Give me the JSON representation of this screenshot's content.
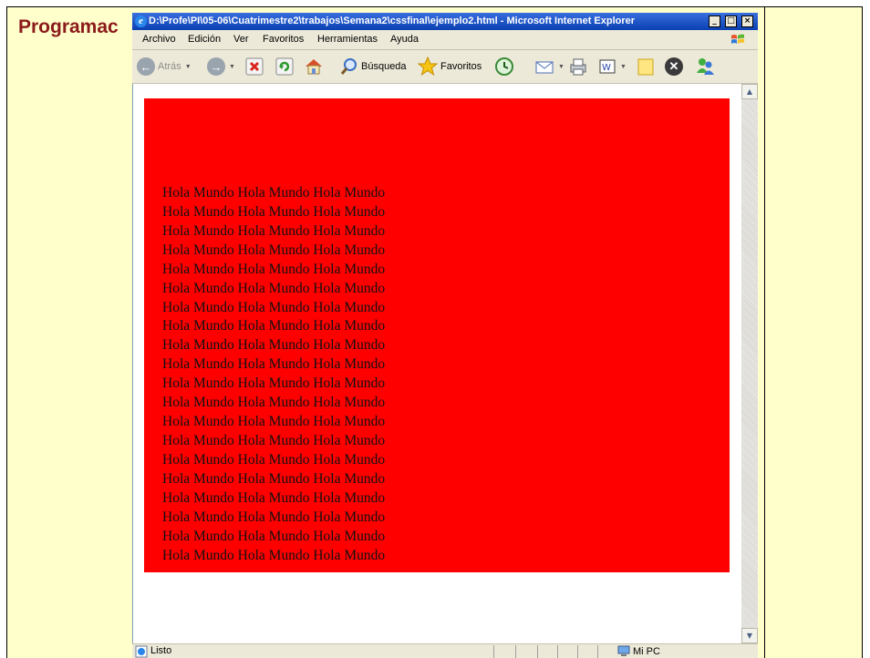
{
  "slide": {
    "title": "Programac"
  },
  "window": {
    "title": "D:\\Profe\\PI\\05-06\\Cuatrimestre2\\trabajos\\Semana2\\cssfinal\\ejemplo2.html - Microsoft Internet Explorer",
    "minimize": "_",
    "maximize": "□",
    "close": "×"
  },
  "menu": {
    "items": [
      "Archivo",
      "Edición",
      "Ver",
      "Favoritos",
      "Herramientas",
      "Ayuda"
    ]
  },
  "toolbar": {
    "back_label": "Atrás",
    "search_label": "Búsqueda",
    "favorites_label": "Favoritos"
  },
  "content": {
    "background_color": "#ff0000",
    "lines": [
      "Hola Mundo Hola Mundo Hola Mundo",
      "Hola Mundo Hola Mundo Hola Mundo",
      "Hola Mundo Hola Mundo Hola Mundo",
      "Hola Mundo Hola Mundo Hola Mundo",
      "Hola Mundo Hola Mundo Hola Mundo",
      "Hola Mundo Hola Mundo Hola Mundo",
      "Hola Mundo Hola Mundo Hola Mundo",
      "Hola Mundo Hola Mundo Hola Mundo",
      "Hola Mundo Hola Mundo Hola Mundo",
      "Hola Mundo Hola Mundo Hola Mundo",
      "Hola Mundo Hola Mundo Hola Mundo",
      "Hola Mundo Hola Mundo Hola Mundo",
      "Hola Mundo Hola Mundo Hola Mundo",
      "Hola Mundo Hola Mundo Hola Mundo",
      "Hola Mundo Hola Mundo Hola Mundo",
      "Hola Mundo Hola Mundo Hola Mundo",
      "Hola Mundo Hola Mundo Hola Mundo",
      "Hola Mundo Hola Mundo Hola Mundo",
      "Hola Mundo Hola Mundo Hola Mundo",
      "Hola Mundo Hola Mundo Hola Mundo"
    ]
  },
  "status": {
    "text": "Listo",
    "zone": "Mi PC"
  }
}
